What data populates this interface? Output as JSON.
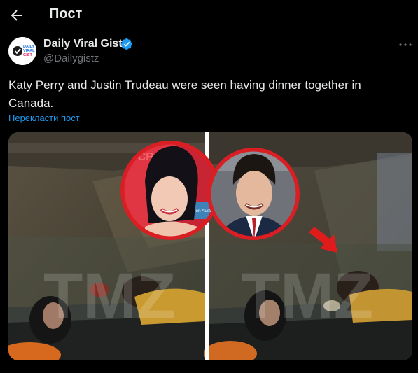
{
  "header": {
    "title": "Пост"
  },
  "post": {
    "author_name": "Daily Viral Gist",
    "handle": "@Dailygistz",
    "avatar_logo_text": [
      "DAILY",
      "VIRAL",
      "GIST"
    ],
    "text": "Katy Perry and Justin Trudeau were seen having dinner together in Canada.",
    "translate_label": "Перекласти пост"
  },
  "media": {
    "watermark": "TMZ",
    "circle_badge_text": "Screen Austral"
  },
  "colors": {
    "accent": "#1d9bf0",
    "circle_border": "#d91e24",
    "arrow": "#e01b1b"
  },
  "icons": [
    "back-arrow-icon",
    "verified-badge-icon",
    "more-options-icon",
    "pointer-arrow-icon"
  ]
}
